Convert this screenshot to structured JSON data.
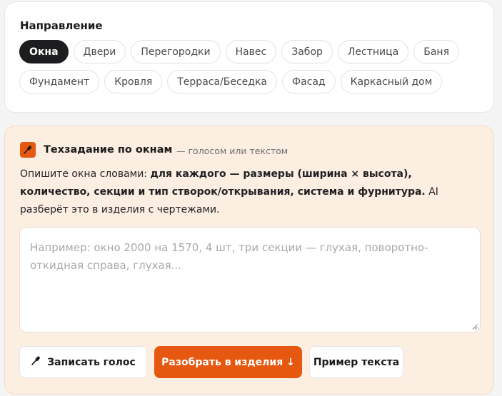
{
  "direction": {
    "title": "Направление",
    "row1": [
      "Окна",
      "Двери",
      "Перегородки",
      "Навес",
      "Забор",
      "Лестница",
      "Баня"
    ],
    "row2": [
      "Фундамент",
      "Кровля",
      "Терраса/Беседка",
      "Фасад",
      "Каркасный дом"
    ],
    "active": "Окна"
  },
  "spec": {
    "icon": "microphone-icon",
    "title": "Техзадание по окнам",
    "subtitle": "— голосом или текстом",
    "desc_pre": "Опишите окна словами: ",
    "desc_bold": "для каждого — размеры (ширина × высота), количество, секции и тип створок/открывания, система и фурнитура.",
    "desc_post": " AI разберёт это в изделия с чертежами.",
    "placeholder": "Например: окно 2000 на 1570, 4 шт, три секции — глухая, поворотно-откидная справа, глухая...",
    "buttons": {
      "voice": "Записать голос",
      "parse": "Разобрать в изделия ↓",
      "example": "Пример текста"
    }
  },
  "colors": {
    "accent": "#e6580f",
    "active_chip": "#1d1d20",
    "panel_bg": "#fdeee2"
  }
}
